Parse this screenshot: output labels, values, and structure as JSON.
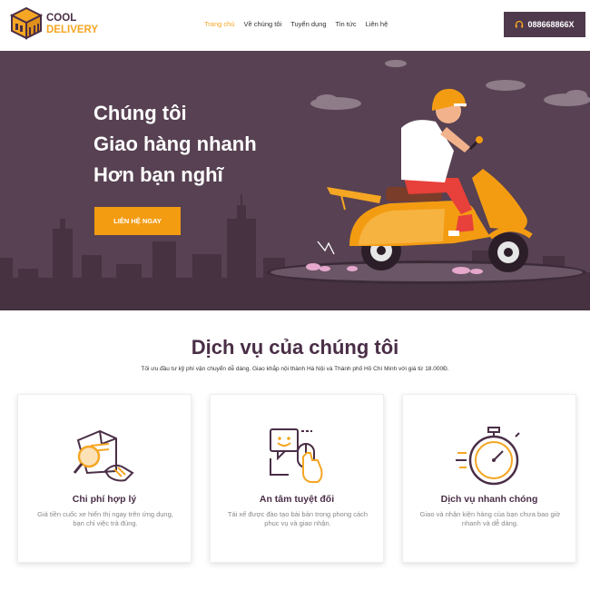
{
  "brand": {
    "line1": "COOL",
    "line2": "DELIVERY"
  },
  "nav": [
    "Trang chủ",
    "Về chúng tôi",
    "Tuyển dụng",
    "Tin tức",
    "Liên hệ"
  ],
  "nav_active": 0,
  "phone": {
    "icon": "headset-icon",
    "label": "088668866X"
  },
  "hero": {
    "lines": [
      "Chúng tôi",
      "Giao hàng nhanh",
      "Hơn bạn nghĩ"
    ],
    "cta": "LIÊN HỆ NGAY"
  },
  "services": {
    "title": "Dịch vụ của chúng tôi",
    "subtitle": "Tối ưu đầu tư kỹ phí vận chuyển dễ dàng. Giao khắp nội thành Hà Nội và Thành phố Hồ Chí Minh với giá từ 18.000Đ.",
    "cards": [
      {
        "icon": "document-magnifier-handshake-icon",
        "title": "Chi phí hợp lý",
        "desc": "Giá tiền cuốc xe hiển thị ngay trên ứng dụng, bạn chỉ việc trả đúng."
      },
      {
        "icon": "chat-touch-icon",
        "title": "An tâm tuyệt đối",
        "desc": "Tài xế được đào tạo bài bản trong phong cách phục vụ và giao nhận."
      },
      {
        "icon": "stopwatch-icon",
        "title": "Dịch vụ nhanh chóng",
        "desc": "Giao và nhận kiện hàng của bạn chưa bao giờ nhanh và dễ dàng."
      }
    ]
  },
  "colors": {
    "primary": "#4a2e46",
    "accent": "#f39c12",
    "hero_bg": "#574152"
  }
}
